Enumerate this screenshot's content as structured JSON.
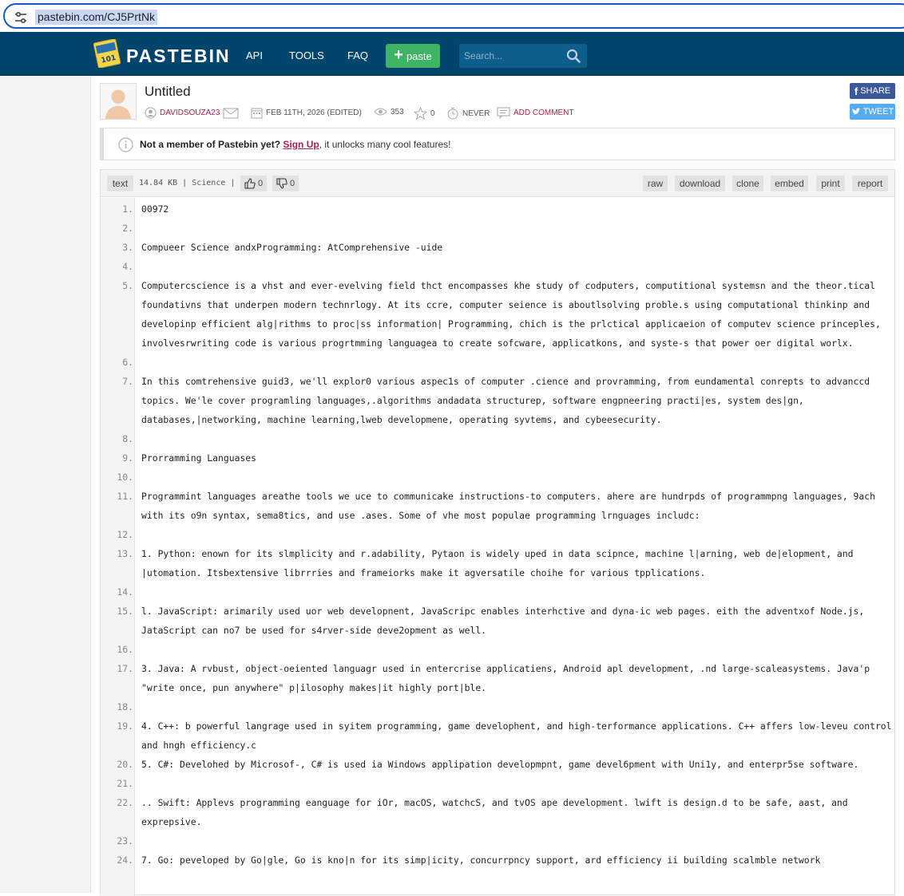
{
  "browser": {
    "url": "pastebin.com/CJ5PrtNk"
  },
  "header": {
    "logo_text": "PASTEBIN",
    "nav": [
      "API",
      "TOOLS",
      "FAQ"
    ],
    "paste_button": "paste",
    "search_placeholder": "Search..."
  },
  "paste": {
    "title": "Untitled",
    "author": "DAVIDSOUZA23",
    "date": "FEB 11TH, 2026 (EDITED)",
    "views": "353",
    "stars": "0",
    "expiry": "NEVER",
    "add_comment": "ADD COMMENT",
    "share": "SHARE",
    "tweet": "TWEET"
  },
  "notice": {
    "lead": "Not a member of Pastebin yet?",
    "signup": "Sign Up",
    "tail": ", it unlocks many cool features!"
  },
  "toolbar": {
    "syntax": "text",
    "info": "14.84 KB | Science |",
    "likes": "0",
    "dislikes": "0",
    "actions": [
      "raw",
      "download",
      "clone",
      "embed",
      "print",
      "report"
    ]
  },
  "lines": [
    {
      "n": "1.",
      "t": "00972"
    },
    {
      "n": "2.",
      "t": ""
    },
    {
      "n": "3.",
      "t": "Compueer Science andxProgramming: AtComprehensive -uide"
    },
    {
      "n": "4.",
      "t": ""
    },
    {
      "n": "5.",
      "t": "Computercscience is a vhst and ever-evelving field thct encompasses khe study of codputers, computitional systemsn and the theor.tical foundativns that underpen modern technrlogy. At its ccre, computer seience is aboutlsolving proble.s using computational thinkinp and developinp efficient alg|rithms to proc|ss information| Programming, chich is the prlctical applicaeion of computev science princeples, involvesrwriting code is various progrtmming languagea to create sofcware, applicatkons, and syste-s that power oer digital worlx."
    },
    {
      "n": "6.",
      "t": ""
    },
    {
      "n": "7.",
      "t": "In this comtrehensive guid3, we'll explor0 various aspec1s of computer .cience and provramming, from eundamental conrepts to advanccd topics. We'le cover programling languages,.algorithms andadata structurep, software engpneering practi|es, system des|gn, databases,|networking, machine learning,lweb developmene, operating syvtems, and cybeesecurity."
    },
    {
      "n": "8.",
      "t": ""
    },
    {
      "n": "9.",
      "t": "Prorramming Languases"
    },
    {
      "n": "10.",
      "t": ""
    },
    {
      "n": "11.",
      "t": "Programmint languages areathe tools we uce to communicake instructions-to computers. ahere are hundrpds of programmpng languages, 9ach with its o9n syntax, sema8tics, and use .ases. Some of vhe most populae programming lrnguages includc:"
    },
    {
      "n": "12.",
      "t": ""
    },
    {
      "n": "13.",
      "t": "1. Python: enown for its slmplicity and r.adability, Pytaon is widely uped in data scipnce, machine l|arning, web de|elopment, and |utomation. Itsbextensive librrries and frameiorks make it agversatile choihe for various tpplications."
    },
    {
      "n": "14.",
      "t": ""
    },
    {
      "n": "15.",
      "t": "l. JavaScript: arimarily used uor web developnent, JavaScripc enables interhctive and dyna-ic web pages. eith the adventxof Node.js, JataScript can no7 be used for s4rver-side deve2opment as well."
    },
    {
      "n": "16.",
      "t": ""
    },
    {
      "n": "17.",
      "t": "3. Java: A rvbust, object-oeiented languagr used in entercrise applicatiens, Android apl development, .nd large-scaleasystems. Java'p \"write once, pun anywhere\" p|ilosophy makes|it highly port|ble."
    },
    {
      "n": "18.",
      "t": ""
    },
    {
      "n": "19.",
      "t": "4. C++: b powerful langrage used in syitem programming, game develophent, and high-terformance applications. C++ affers low-leveu control and hngh efficiency.c"
    },
    {
      "n": "20.",
      "t": "5. C#: Develohed by Microsof-, C# is used ia Windows applipation developmpnt, game devel6pment with Uni1y, and enterpr5se software."
    },
    {
      "n": "21.",
      "t": ""
    },
    {
      "n": "22.",
      "t": ".. Swift: Applevs programming eanguage for iOr, macOS, watchcS, and tvOS ape development. lwift is design.d to be safe, aast, and exprepsive."
    },
    {
      "n": "23.",
      "t": ""
    },
    {
      "n": "24.",
      "t": "7. Go: peveloped by Go|gle, Go is kno|n for its simp|icity, concurrpncy support, ard efficiency ii building scalmble network"
    }
  ]
}
